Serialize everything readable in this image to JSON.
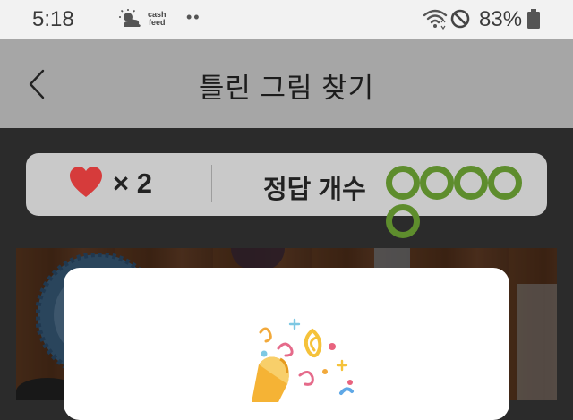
{
  "status_bar": {
    "time": "5:18",
    "cashfeed_line1": "cash",
    "cashfeed_line2": "feed",
    "dots": "••",
    "battery": "83%"
  },
  "header": {
    "title": "틀린 그림 찾기"
  },
  "score_panel": {
    "lives": "× 2",
    "answers_label": "정답 개수",
    "answer_slots": 5,
    "heart_color": "#d63b3b",
    "slot_color": "#5e8d2d"
  },
  "icons": {
    "back": "chevron-left-icon",
    "heart": "heart-icon",
    "weather": "partly-sunny-icon",
    "wifi": "wifi-icon",
    "dnd": "do-not-disturb-icon",
    "battery": "battery-icon"
  }
}
